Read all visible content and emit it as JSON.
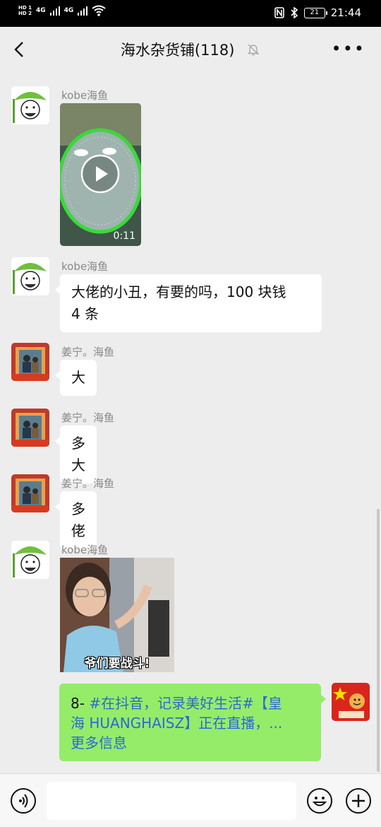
{
  "status_bar": {
    "hd1": "HD 1",
    "hd2": "HD 2",
    "net1": "4G",
    "net2": "4G",
    "battery": "21",
    "time": "21:44"
  },
  "header": {
    "title": "海水杂货铺(118)",
    "back_icon": "chevron-left-icon",
    "mute_icon": "bell-off-icon",
    "more_icon": "more-dots-icon"
  },
  "messages": [
    {
      "sender": "kobe海鱼",
      "type": "video",
      "duration": "0:11"
    },
    {
      "sender": "kobe海鱼",
      "type": "text",
      "text_line1": "大佬的小丑，有要的吗，100 块钱",
      "text_line2": "4 条"
    },
    {
      "sender": "姜宁。海鱼",
      "type": "text",
      "text": "大"
    },
    {
      "sender": "姜宁。海鱼",
      "type": "text",
      "text": "多大"
    },
    {
      "sender": "姜宁。海鱼",
      "type": "text",
      "text": "多佬"
    },
    {
      "sender": "kobe海鱼",
      "type": "sticker",
      "caption": "爷们要战斗!"
    },
    {
      "sender": "me",
      "type": "text",
      "line1_prefix": "8- ",
      "line1_tag": "#在抖音，记录美好生活#",
      "line1_tail": "【皇",
      "line2": "海 HUANGHAISZ】正在直播，...",
      "line3": "更多信息"
    }
  ],
  "input_bar": {
    "voice_icon": "voice-icon",
    "emoji_icon": "emoji-icon",
    "plus_icon": "plus-icon",
    "input_value": ""
  },
  "colors": {
    "background": "#ededed",
    "my_bubble": "#95ec69",
    "other_bubble": "#ffffff",
    "hashtag": "#2b6ad3"
  }
}
